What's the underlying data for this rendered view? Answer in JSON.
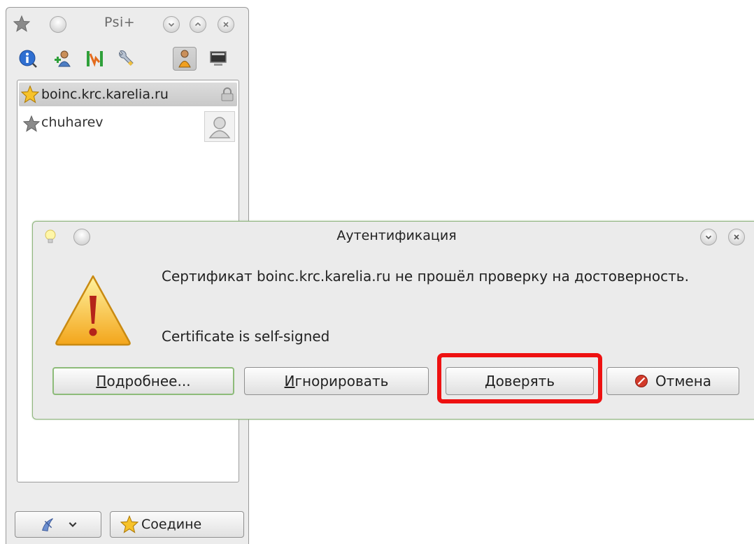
{
  "psi_window": {
    "title": "Psi+",
    "account": {
      "name": "boinc.krc.karelia.ru"
    },
    "contacts": [
      {
        "name": "chuharev"
      }
    ],
    "status_button": {
      "label": "Соедине"
    },
    "icons": {
      "titlebar": [
        "star-icon",
        "circle-button-icon",
        "minimize-chevron-icon",
        "maximize-chevron-icon",
        "close-x-icon"
      ],
      "toolbar": [
        "info-icon",
        "add-contact-icon",
        "groupchat-icon",
        "options-wrench-icon",
        "show-offline-contacts-icon",
        "xml-console-icon"
      ]
    }
  },
  "auth_dialog": {
    "title": "Аутентификация",
    "message": "Сертификат boinc.krc.karelia.ru не прошёл проверку на достоверность.",
    "detail": "Certificate is self-signed",
    "buttons": {
      "details": {
        "label": "Подробнее...",
        "mnemonic": "П",
        "rest": "одробнее..."
      },
      "ignore": {
        "label": "Игнорировать",
        "mnemonic": "И",
        "rest": "гнорировать"
      },
      "trust": {
        "label": "Доверять",
        "mnemonic": "Д",
        "rest": "оверять"
      },
      "cancel": {
        "label": "Отмена"
      }
    }
  },
  "colors": {
    "highlight": "#ee1111",
    "dialog_border": "#8fb47e",
    "window_bg": "#ececec"
  }
}
